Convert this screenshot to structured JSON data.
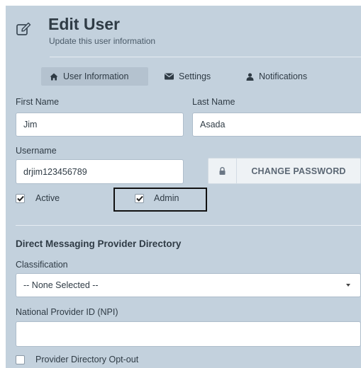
{
  "header": {
    "icon": "edit-icon",
    "title": "Edit User",
    "subtitle": "Update this user information"
  },
  "tabs": [
    {
      "label": "User Information",
      "icon": "home-icon",
      "active": true
    },
    {
      "label": "Settings",
      "icon": "envelope-icon",
      "active": false
    },
    {
      "label": "Notifications",
      "icon": "user-icon",
      "active": false
    }
  ],
  "form": {
    "first_name": {
      "label": "First Name",
      "value": "Jim"
    },
    "last_name": {
      "label": "Last Name",
      "value": "Asada"
    },
    "username": {
      "label": "Username",
      "value": "drjim123456789"
    },
    "change_password": {
      "label": "CHANGE PASSWORD",
      "icon": "lock-icon"
    },
    "active": {
      "label": "Active",
      "checked": true
    },
    "admin": {
      "label": "Admin",
      "checked": true
    }
  },
  "direct_messaging": {
    "title": "Direct Messaging Provider Directory",
    "classification": {
      "label": "Classification",
      "value": "-- None Selected --"
    },
    "npi": {
      "label": "National Provider ID (NPI)",
      "value": ""
    },
    "opt_out": {
      "label": "Provider Directory Opt-out",
      "checked": false
    }
  },
  "colors": {
    "panel_bg": "#c3d1dd",
    "active_tab_bg": "#b4c2cf",
    "text": "#2f3b45",
    "highlight_border": "#111111"
  }
}
